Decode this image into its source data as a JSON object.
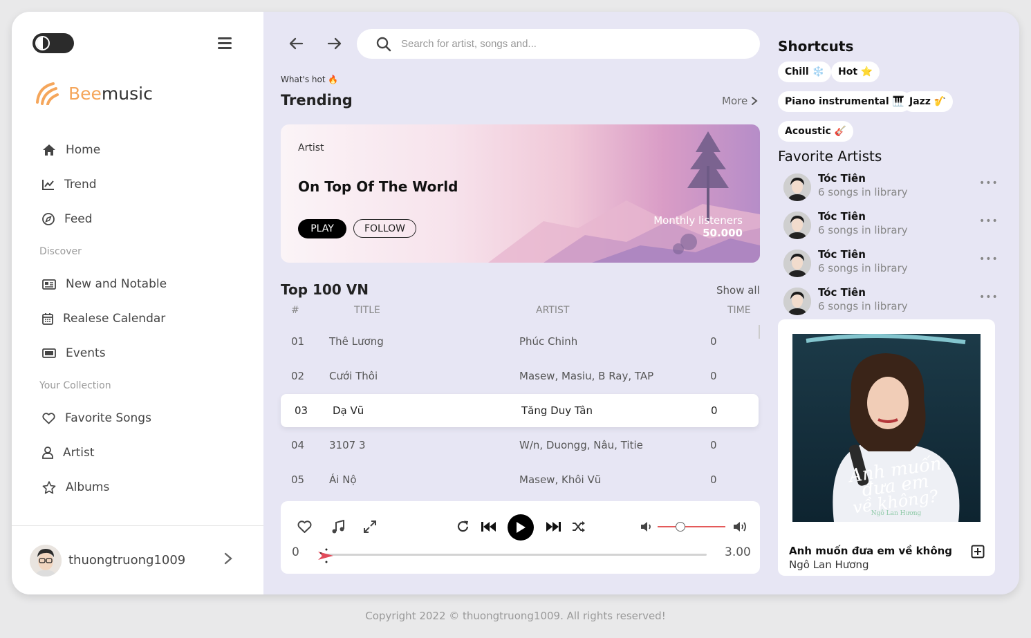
{
  "brand": {
    "name_part1": "Bee",
    "name_part2": "music"
  },
  "sidebar": {
    "nav": [
      {
        "label": "Home",
        "icon": "home-icon"
      },
      {
        "label": "Trend",
        "icon": "chart-line-icon"
      },
      {
        "label": "Feed",
        "icon": "compass-icon"
      }
    ],
    "discover_label": "Discover",
    "discover": [
      {
        "label": "New and Notable",
        "icon": "newspaper-icon"
      },
      {
        "label": "Realese Calendar",
        "icon": "calendar-icon"
      },
      {
        "label": "Events",
        "icon": "ticket-icon"
      }
    ],
    "collection_label": "Your Collection",
    "collection": [
      {
        "label": "Favorite Songs",
        "icon": "heart-icon"
      },
      {
        "label": "Artist",
        "icon": "user-icon"
      },
      {
        "label": "Albums",
        "icon": "star-icon"
      }
    ],
    "username": "thuongtruong1009"
  },
  "search": {
    "placeholder": "Search for artist, songs and..."
  },
  "trending": {
    "kicker": "What's hot 🔥",
    "title": "Trending",
    "more": "More",
    "banner": {
      "label": "Artist",
      "title": "On Top Of The World",
      "play": "PLAY",
      "follow": "FOLLOW",
      "listeners_label": "Monthly listeners",
      "listeners_value": "50.000"
    }
  },
  "top100": {
    "title": "Top 100 VN",
    "show_all": "Show all",
    "columns": {
      "num": "#",
      "title": "TITLE",
      "artist": "ARTIST",
      "time": "TIME"
    },
    "rows": [
      {
        "num": "01",
        "title": "Thê Lương",
        "artist": "Phúc Chinh",
        "time": "0"
      },
      {
        "num": "02",
        "title": "Cưới Thôi",
        "artist": "Masew, Masiu, B Ray, TAP",
        "time": "0"
      },
      {
        "num": "03",
        "title": "Dạ Vũ",
        "artist": "Tăng Duy Tân",
        "time": "0"
      },
      {
        "num": "04",
        "title": "3107 3",
        "artist": "W/n, Duongg, Nâu, Titie",
        "time": "0"
      },
      {
        "num": "05",
        "title": "Ái Nộ",
        "artist": "Masew, Khôi Vũ",
        "time": "0"
      }
    ],
    "active_row": 2
  },
  "player": {
    "current_time": "0",
    "total_time": "3.00",
    "progress": 0,
    "volume": 0.35
  },
  "shortcuts": {
    "title": "Shortcuts",
    "chips": [
      "Chill ❄️",
      "Hot ⭐",
      "Piano instrumental 🎹",
      "Jazz 🎷",
      "Acoustic 🎸"
    ]
  },
  "favorites": {
    "title": "Favorite Artists",
    "artists": [
      {
        "name": "Tóc Tiên",
        "count": "6 songs in library"
      },
      {
        "name": "Tóc Tiên",
        "count": "6 songs in library"
      },
      {
        "name": "Tóc Tiên",
        "count": "6 songs in library"
      },
      {
        "name": "Tóc Tiên",
        "count": "6 songs in library"
      }
    ],
    "more": "•••"
  },
  "now_playing": {
    "title": "Anh muốn đưa em về không",
    "artist": "Ngô Lan Hương",
    "art_text_line1": "Anh muốn",
    "art_text_line2": "đưa em",
    "art_text_line3": "về không?",
    "art_credit": "Ngô Lan Hương"
  },
  "footer": {
    "copyright": "Copyright 2022 © thuongtruong1009. All rights reserved!"
  },
  "colors": {
    "brand": "#f5a65b",
    "background": "#e7e6f4",
    "volume": "#e45a5a"
  }
}
